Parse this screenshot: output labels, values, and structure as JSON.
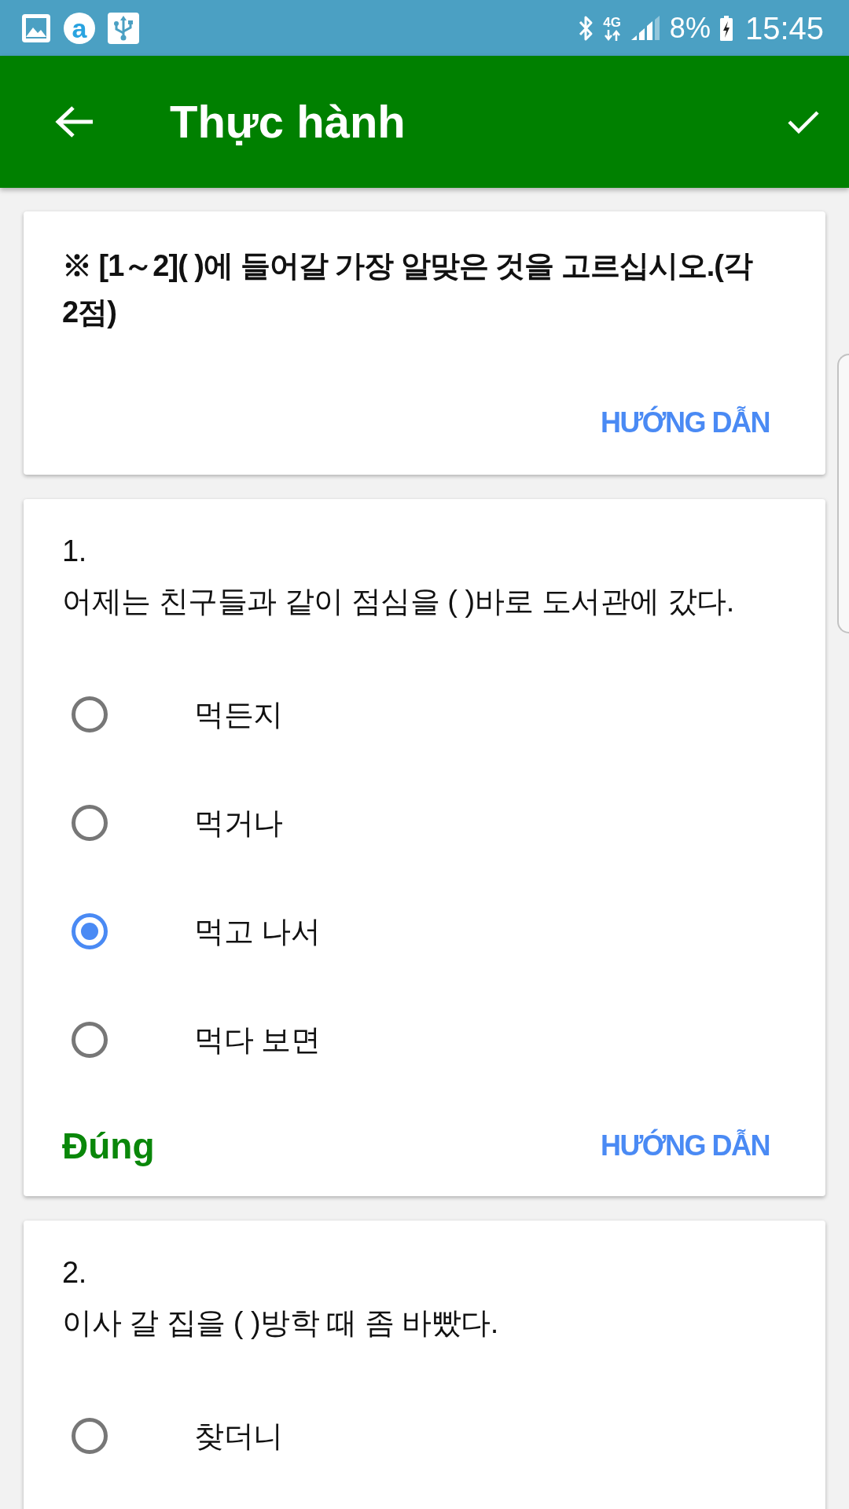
{
  "status_bar": {
    "notification_icons": [
      {
        "kind": "image"
      },
      {
        "kind": "app",
        "letter": "a"
      },
      {
        "kind": "usb"
      }
    ],
    "network": "4G",
    "battery": "8%",
    "time": "15:45"
  },
  "app_bar": {
    "title": "Thực hành"
  },
  "instruction": {
    "text": "※ [1～2]( )에 들어갈 가장 알맞은 것을 고르십시오.(각 2점)",
    "button": "HƯỚNG DẪN"
  },
  "questions": [
    {
      "number": "1.",
      "text": "어제는 친구들과 같이 점심을 ( )바로 도서관에 갔다.",
      "options": [
        {
          "label": "먹든지",
          "selected": false
        },
        {
          "label": "먹거나",
          "selected": false
        },
        {
          "label": "먹고 나서",
          "selected": true
        },
        {
          "label": "먹다 보면",
          "selected": false
        }
      ],
      "result": {
        "label": "Đúng",
        "correct": true
      },
      "button": "HƯỚNG DẪN"
    },
    {
      "number": "2.",
      "text": "이사 갈 집을 ( )방학 때 좀 바빴다.",
      "options": [
        {
          "label": "찾더니",
          "selected": false
        }
      ]
    }
  ]
}
